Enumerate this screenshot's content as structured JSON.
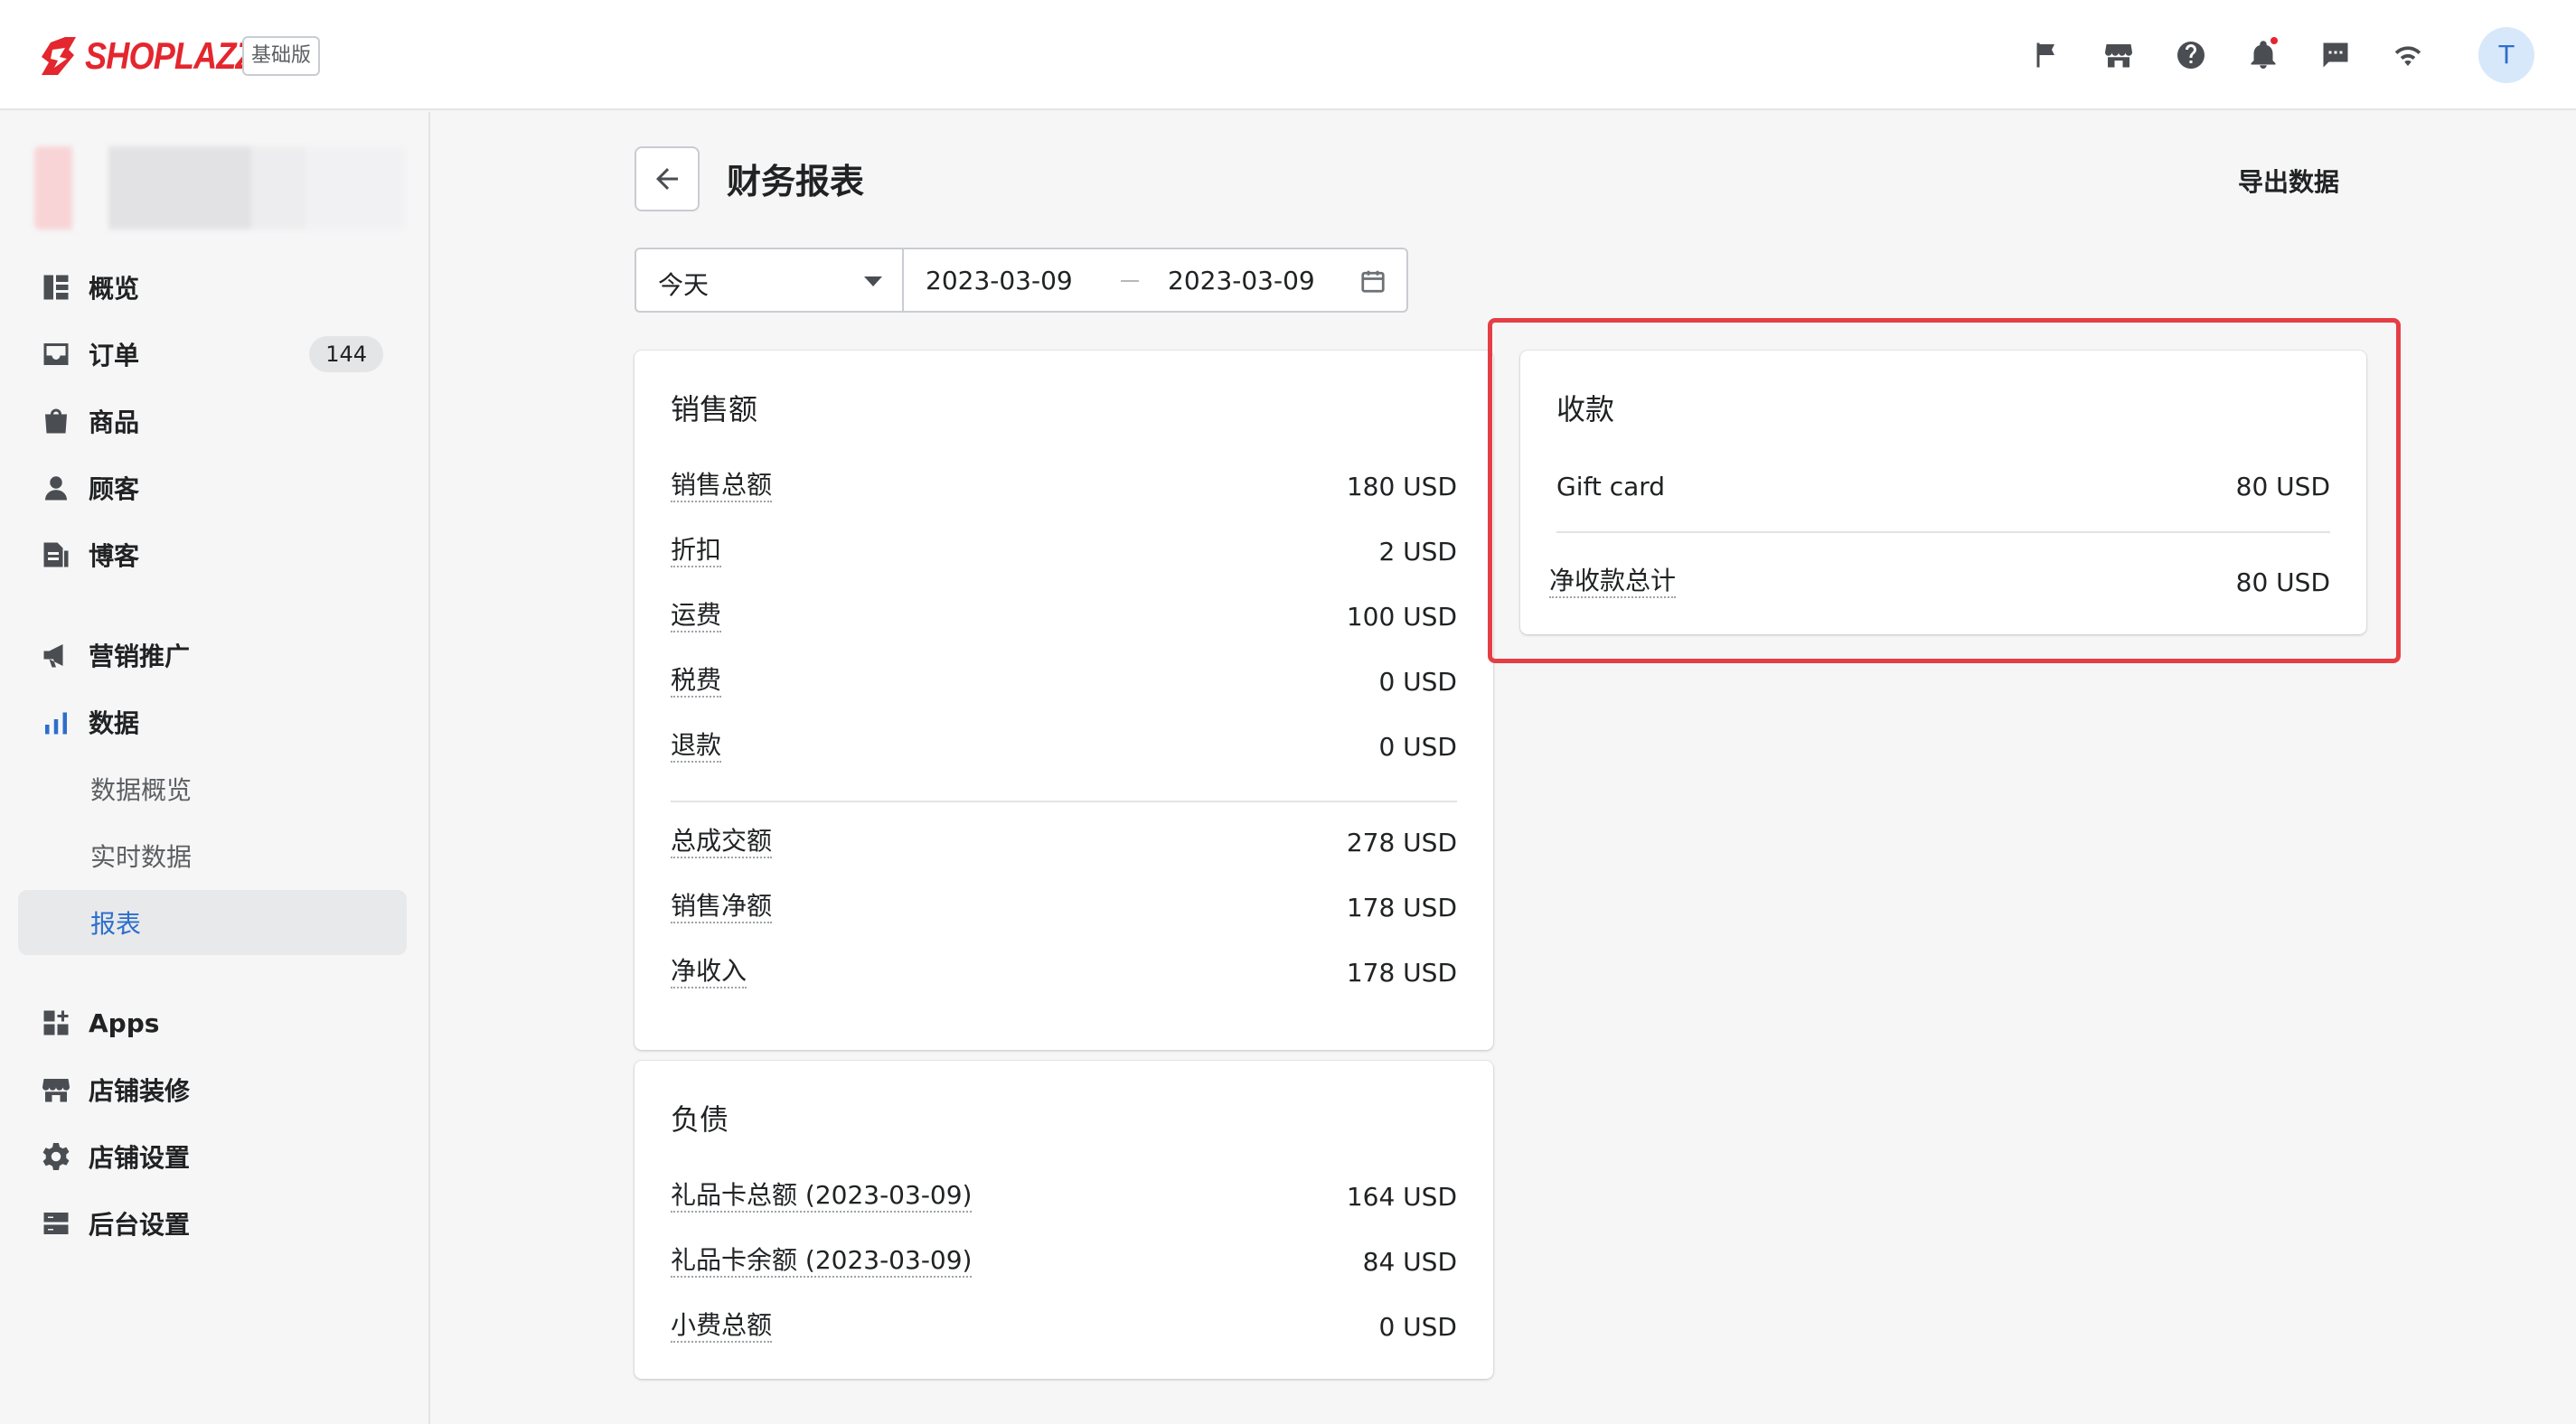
{
  "topbar": {
    "logo_text": "SHOPLAZZA",
    "plan_badge": "基础版",
    "avatar_initial": "T",
    "icons": [
      "flag-icon",
      "store-icon",
      "help-icon",
      "bell-icon",
      "chat-icon",
      "wifi-icon"
    ]
  },
  "sidebar": {
    "items": [
      {
        "label": "概览",
        "icon": "overview-icon"
      },
      {
        "label": "订单",
        "icon": "orders-icon",
        "count": "144"
      },
      {
        "label": "商品",
        "icon": "products-icon"
      },
      {
        "label": "顾客",
        "icon": "customers-icon"
      },
      {
        "label": "博客",
        "icon": "blog-icon"
      },
      {
        "label": "营销推广",
        "icon": "megaphone-icon"
      },
      {
        "label": "数据",
        "icon": "analytics-icon"
      },
      {
        "label": "Apps",
        "icon": "apps-icon"
      },
      {
        "label": "店铺装修",
        "icon": "store-design-icon"
      },
      {
        "label": "店铺设置",
        "icon": "settings-icon"
      },
      {
        "label": "后台设置",
        "icon": "admin-settings-icon"
      }
    ],
    "sub_items": [
      {
        "label": "数据概览"
      },
      {
        "label": "实时数据"
      },
      {
        "label": "报表",
        "active": true
      }
    ]
  },
  "page": {
    "title": "财务报表",
    "export_label": "导出数据",
    "date_preset": "今天",
    "date_start": "2023-03-09",
    "date_end": "2023-03-09"
  },
  "sales": {
    "title": "销售额",
    "rows": [
      {
        "label": "销售总额",
        "value": "180 USD"
      },
      {
        "label": "折扣",
        "value": "2 USD"
      },
      {
        "label": "运费",
        "value": "100 USD"
      },
      {
        "label": "税费",
        "value": "0 USD"
      },
      {
        "label": "退款",
        "value": "0 USD"
      }
    ],
    "totals": [
      {
        "label": "总成交额",
        "value": "278 USD"
      },
      {
        "label": "销售净额",
        "value": "178 USD"
      },
      {
        "label": "净收入",
        "value": "178 USD"
      }
    ]
  },
  "liabilities": {
    "title": "负债",
    "rows": [
      {
        "label": "礼品卡总额 (2023-03-09)",
        "value": "164 USD"
      },
      {
        "label": "礼品卡余额 (2023-03-09)",
        "value": "84 USD"
      },
      {
        "label": "小费总额",
        "value": "0 USD"
      }
    ]
  },
  "payments": {
    "title": "收款",
    "rows": [
      {
        "label": "Gift card",
        "value": "80 USD"
      }
    ],
    "total": {
      "label": "净收款总计",
      "value": "80 USD"
    }
  },
  "colors": {
    "brand": "#e4262e",
    "accent": "#2c6ecb",
    "highlight_border": "#e53e45"
  }
}
